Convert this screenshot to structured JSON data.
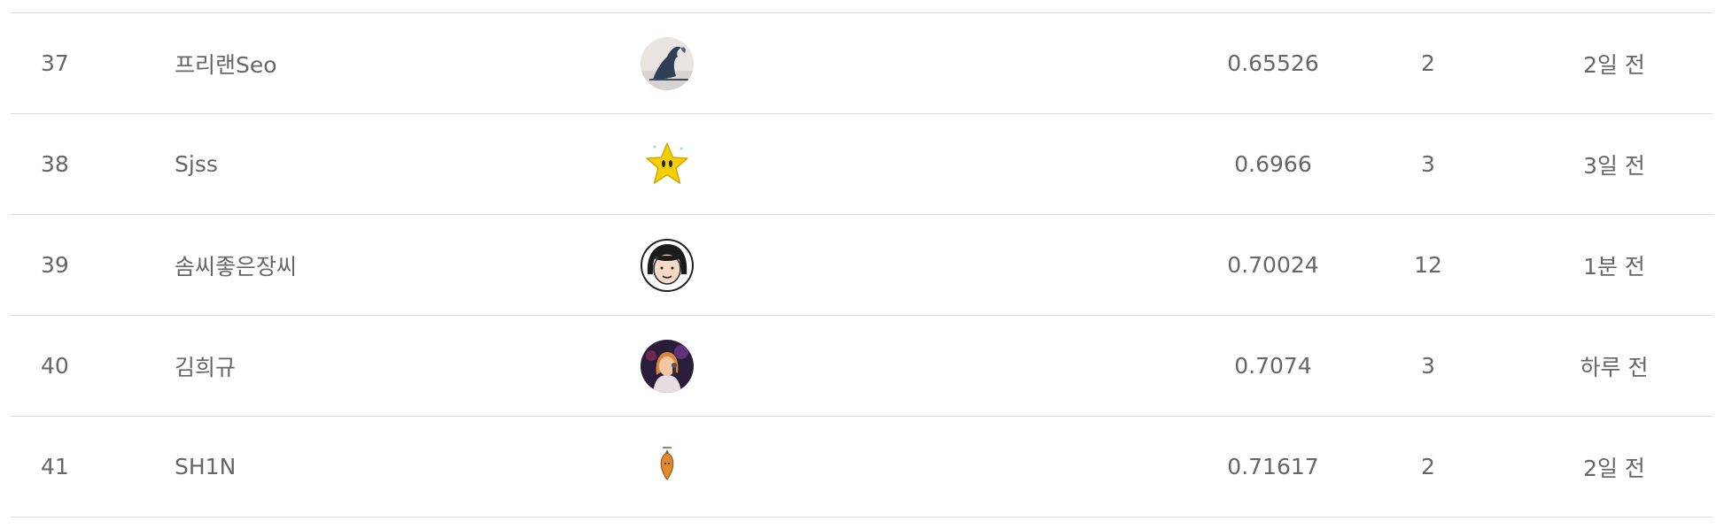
{
  "rows": [
    {
      "rank": "37",
      "nickname": "프리랜Seo",
      "avatar_icon": "wave-painting-avatar",
      "score": "0.65526",
      "submissions": "2",
      "last": "2일 전"
    },
    {
      "rank": "38",
      "nickname": "Sjss",
      "avatar_icon": "star-character-avatar",
      "score": "0.6966",
      "submissions": "3",
      "last": "3일 전"
    },
    {
      "rank": "39",
      "nickname": "솜씨좋은장씨",
      "avatar_icon": "cartoon-face-avatar",
      "score": "0.70024",
      "submissions": "12",
      "last": "1분 전"
    },
    {
      "rank": "40",
      "nickname": "김희규",
      "avatar_icon": "singer-photo-avatar",
      "score": "0.7074",
      "submissions": "3",
      "last": "하루 전"
    },
    {
      "rank": "41",
      "nickname": "SH1N",
      "avatar_icon": "carrot-character-avatar",
      "score": "0.71617",
      "submissions": "2",
      "last": "2일 전"
    }
  ],
  "colors": {
    "text": "#666666",
    "divider": "#dcdcdc",
    "background": "#ffffff"
  }
}
